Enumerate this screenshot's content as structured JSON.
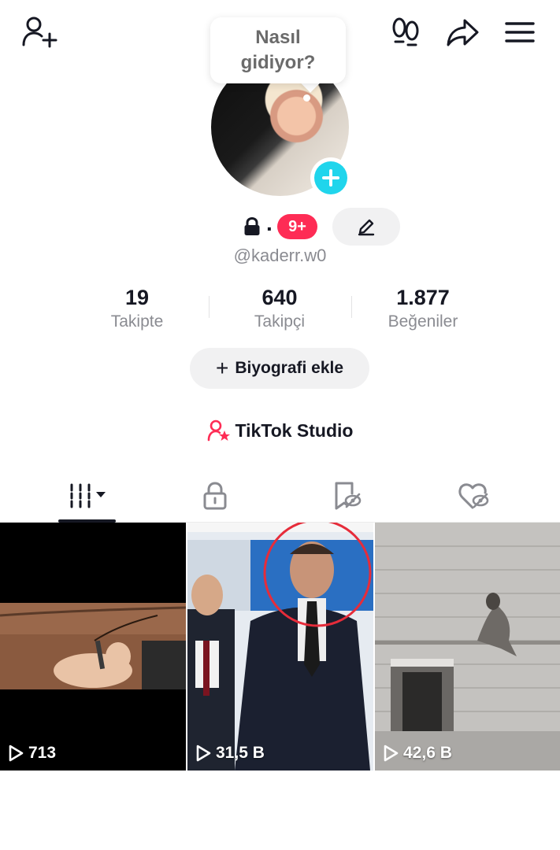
{
  "top_bar": {
    "add_friend_icon": "person-plus-icon",
    "footprint_icon": "footprint-icon",
    "share_icon": "share-arrow-icon",
    "menu_icon": "hamburger-menu-icon"
  },
  "status_bubble": {
    "line1": "Nasıl",
    "line2": "gidiyor?"
  },
  "profile": {
    "name_separator": ".",
    "notification_badge": "9+",
    "username": "@kaderr.w0"
  },
  "stats": [
    {
      "value": "19",
      "label": "Takipte"
    },
    {
      "value": "640",
      "label": "Takipçi"
    },
    {
      "value": "1.877",
      "label": "Beğeniler"
    }
  ],
  "bio_button": {
    "plus": "+",
    "label": "Biyografi ekle"
  },
  "studio": {
    "label": "TikTok Studio"
  },
  "tabs": [
    {
      "name": "videos",
      "icon": "grid-icon",
      "selected": true
    },
    {
      "name": "private",
      "icon": "lock-icon",
      "selected": false
    },
    {
      "name": "favorites",
      "icon": "bookmark-hidden-icon",
      "selected": false
    },
    {
      "name": "liked",
      "icon": "heart-hidden-icon",
      "selected": false
    }
  ],
  "videos": [
    {
      "views": "713"
    },
    {
      "views": "31,5 B"
    },
    {
      "views": "42,6 B"
    }
  ],
  "colors": {
    "accent_red": "#fe2c55",
    "accent_cyan": "#20d5ec",
    "text_primary": "#161823",
    "text_secondary": "#8a8b91",
    "button_bg": "#f1f1f2"
  }
}
